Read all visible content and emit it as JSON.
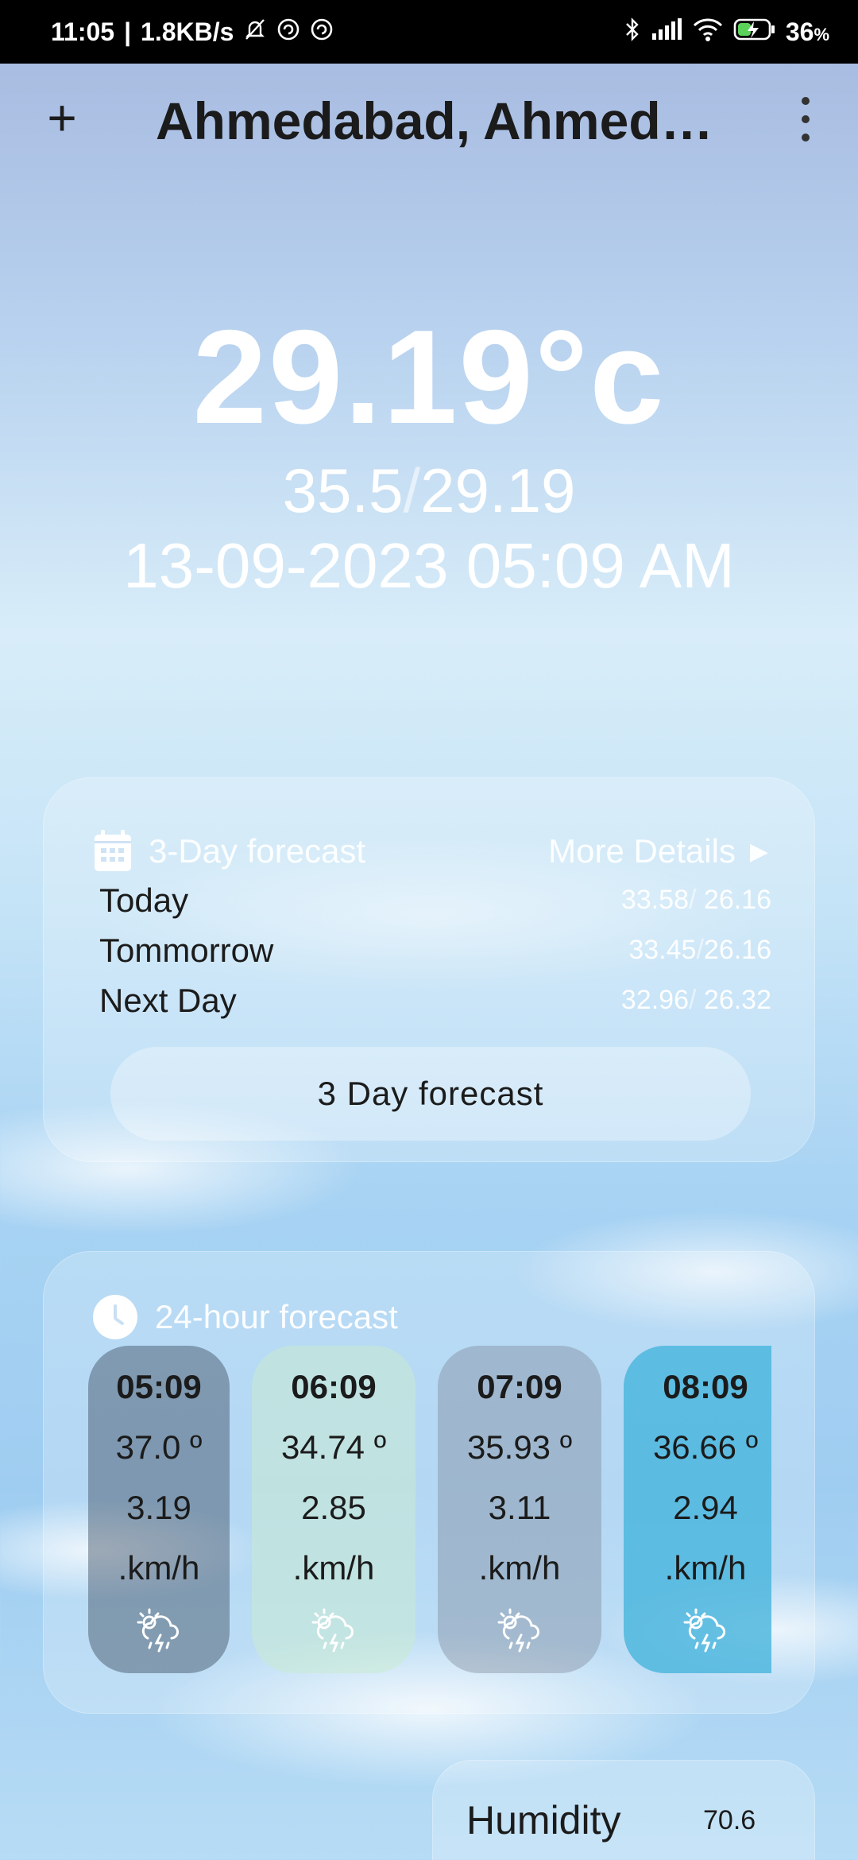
{
  "status_bar": {
    "time": "11:05",
    "speed": "1.8KB/s",
    "battery": "36",
    "battery_unit": "%"
  },
  "header": {
    "add_label": "+",
    "city": "Ahmedabad, Ahmed…"
  },
  "current": {
    "temperature": "29.19°c",
    "max": "35.5",
    "min": "29.19",
    "datetime": "13-09-2023 05:09 AM"
  },
  "forecast3": {
    "title": "3-Day forecast",
    "more_label": "More Details",
    "days": [
      {
        "day": "Today",
        "max": "33.58",
        "min": "26.16",
        "sep": "/ "
      },
      {
        "day": "Tommorrow",
        "max": "33.45",
        "min": "26.16",
        "sep": "/"
      },
      {
        "day": "Next Day",
        "max": "32.96",
        "min": "26.32",
        "sep": "/ "
      }
    ],
    "button_label": "3 Day forecast"
  },
  "forecast24": {
    "title": "24-hour forecast",
    "hours": [
      {
        "time": "05:09",
        "temp": "37.0 º",
        "wind": "3.19",
        "unit": ".km/h",
        "icon": "thunder-rain-sun-icon"
      },
      {
        "time": "06:09",
        "temp": "34.74 º",
        "wind": "2.85",
        "unit": ".km/h",
        "icon": "thunder-rain-sun-icon"
      },
      {
        "time": "07:09",
        "temp": "35.93 º",
        "wind": "3.11",
        "unit": ".km/h",
        "icon": "thunder-rain-sun-icon"
      },
      {
        "time": "08:09",
        "temp": "36.66 º",
        "wind": "2.94",
        "unit": ".km/h",
        "icon": "thunder-rain-sun-icon"
      }
    ]
  },
  "humidity": {
    "label": "Humidity",
    "value": "70.6"
  }
}
